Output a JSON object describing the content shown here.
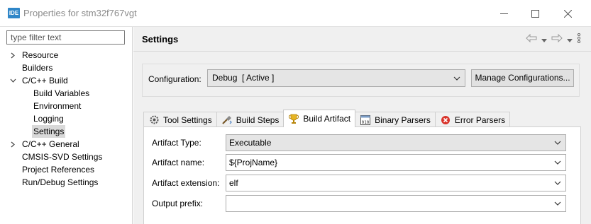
{
  "window": {
    "icon_text": "IDE",
    "title": "Properties for stm32f767vgt"
  },
  "left": {
    "filter_placeholder": "type filter text",
    "tree": [
      {
        "label": "Resource",
        "level": 0,
        "arrow": "collapsed"
      },
      {
        "label": "Builders",
        "level": 0,
        "arrow": "none"
      },
      {
        "label": "C/C++ Build",
        "level": 0,
        "arrow": "expanded"
      },
      {
        "label": "Build Variables",
        "level": 1,
        "arrow": "none"
      },
      {
        "label": "Environment",
        "level": 1,
        "arrow": "none"
      },
      {
        "label": "Logging",
        "level": 1,
        "arrow": "none"
      },
      {
        "label": "Settings",
        "level": 1,
        "arrow": "none",
        "selected": true
      },
      {
        "label": "C/C++ General",
        "level": 0,
        "arrow": "collapsed"
      },
      {
        "label": "CMSIS-SVD Settings",
        "level": 0,
        "arrow": "none"
      },
      {
        "label": "Project References",
        "level": 0,
        "arrow": "none"
      },
      {
        "label": "Run/Debug Settings",
        "level": 0,
        "arrow": "none"
      }
    ]
  },
  "main": {
    "title": "Settings",
    "configuration": {
      "label": "Configuration:",
      "value": "Debug  [ Active ]",
      "manage_button": "Manage Configurations..."
    },
    "tabs": [
      {
        "label": "Tool Settings",
        "icon": "tool-settings-icon"
      },
      {
        "label": "Build Steps",
        "icon": "build-steps-icon"
      },
      {
        "label": "Build Artifact",
        "icon": "trophy-icon",
        "active": true
      },
      {
        "label": "Binary Parsers",
        "icon": "binary-icon"
      },
      {
        "label": "Error Parsers",
        "icon": "error-icon"
      }
    ],
    "fields": [
      {
        "label": "Artifact Type:",
        "value": "Executable",
        "kind": "combo"
      },
      {
        "label": "Artifact name:",
        "value": "${ProjName}",
        "kind": "editable"
      },
      {
        "label": "Artifact extension:",
        "value": "elf",
        "kind": "editable"
      },
      {
        "label": "Output prefix:",
        "value": "",
        "kind": "editable"
      }
    ]
  },
  "colors": {
    "accent": "#2f86c8",
    "panel_bg": "#f0f0f0",
    "selected_bg": "#d9d9d9"
  }
}
